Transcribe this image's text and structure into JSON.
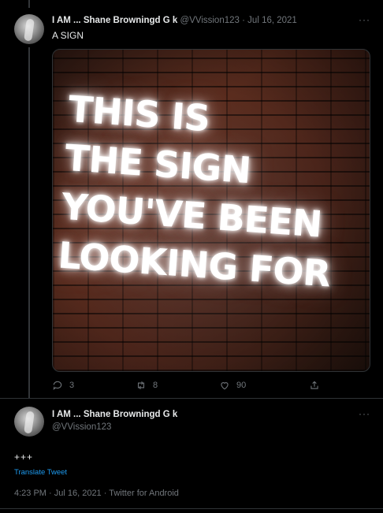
{
  "tweet1": {
    "name": "I AM ... Shane Browningd G k",
    "handle": "@VVission123",
    "separator": "·",
    "date": "Jul 16, 2021",
    "text": "A SIGN",
    "more_icon": "ellipsis-icon",
    "more_label": "···",
    "image": {
      "sign_lines": [
        "THIS IS",
        "THE SIGN",
        "YOU'VE BEEN",
        "LOOKING FOR"
      ]
    },
    "actions": {
      "reply": {
        "icon": "reply-icon",
        "count": "3"
      },
      "retweet": {
        "icon": "retweet-icon",
        "count": "8"
      },
      "like": {
        "icon": "heart-icon",
        "count": "90"
      },
      "share": {
        "icon": "share-icon"
      }
    }
  },
  "tweet2": {
    "name": "I AM ... Shane Browningd G k",
    "handle": "@VVission123",
    "text": "+++",
    "translate_label": "Translate Tweet",
    "more_label": "···",
    "meta": "4:23 PM · Jul 16, 2021 · Twitter for Android"
  },
  "colors": {
    "background": "#000000",
    "text": "#e7e9ea",
    "muted": "#71767b",
    "accent": "#1d9bf0",
    "border": "#2f3336"
  }
}
